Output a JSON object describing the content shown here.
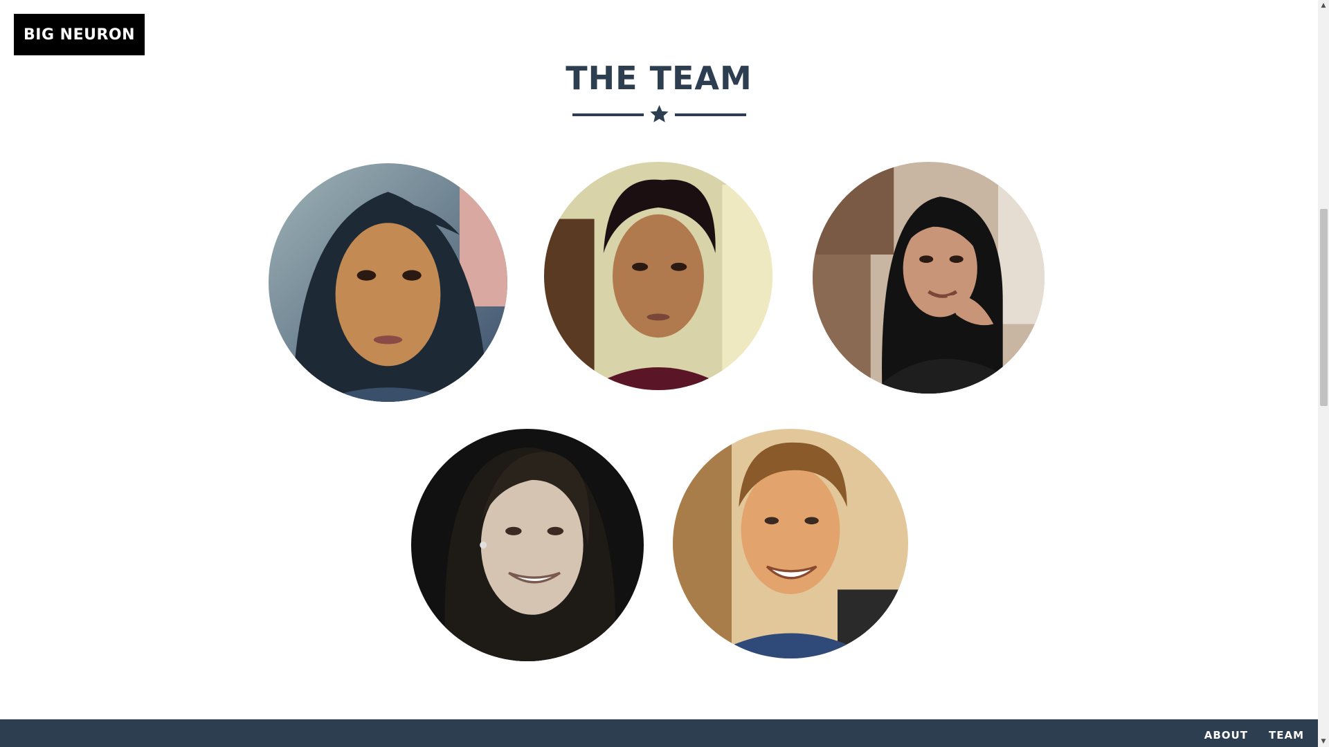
{
  "header": {
    "brand": "BIG NEURON"
  },
  "section": {
    "title": "THE TEAM",
    "divider_icon": "star-icon"
  },
  "team": {
    "members": [
      {
        "photo": "portrait-woman-dark-hair"
      },
      {
        "photo": "portrait-man-dark-hair"
      },
      {
        "photo": "portrait-woman-hand-on-chin"
      },
      {
        "photo": "portrait-woman-smiling-sepia"
      },
      {
        "photo": "portrait-man-smiling"
      }
    ]
  },
  "footer": {
    "nav": [
      "ABOUT",
      "TEAM"
    ]
  },
  "colors": {
    "accent": "#2c3e50",
    "brand_bg": "#000000",
    "background": "#ffffff"
  }
}
